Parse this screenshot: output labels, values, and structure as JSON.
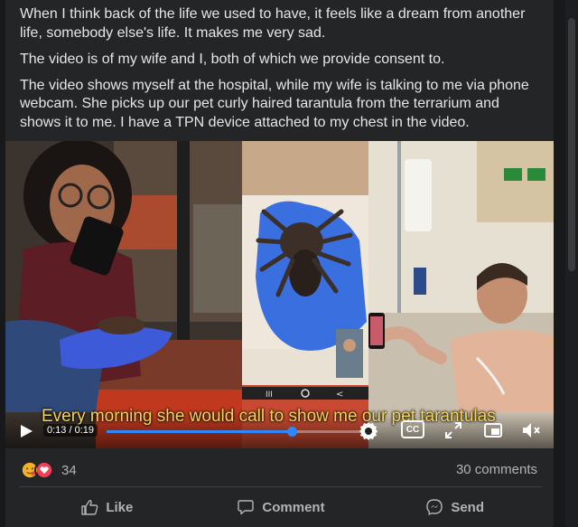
{
  "post": {
    "paragraphs": [
      "When I think back of the life we used to have, it feels like a dream from another life, somebody else's life. It makes me very sad.",
      "The video is of my wife and I, both of which we provide consent to.",
      "The video shows myself at the hospital, while my wife is talking to me via phone webcam. She picks up our pet curly haired tarantula from the terrarium and shows it to me. I have a TPN device attached to my chest in the video."
    ]
  },
  "video": {
    "time_label": "0:13 / 0:19",
    "progress_fraction": 0.684,
    "caption": "Every morning she would call to show me our pet tarantulas",
    "controls": [
      "play-icon",
      "gear-icon",
      "closed-captions-icon",
      "expand-icon",
      "picture-in-picture-icon",
      "volume-icon"
    ],
    "cc_label": "CC",
    "accent": "#2d88ff"
  },
  "reactions": {
    "icons": [
      "care-reaction-icon",
      "love-reaction-icon"
    ],
    "count": "34",
    "comments": "30 comments"
  },
  "actions": {
    "like": "Like",
    "comment": "Comment",
    "send": "Send"
  },
  "colors": {
    "card_bg": "#242526",
    "page_bg": "#18191a",
    "text": "#e4e6eb",
    "muted": "#b0b3b8"
  }
}
